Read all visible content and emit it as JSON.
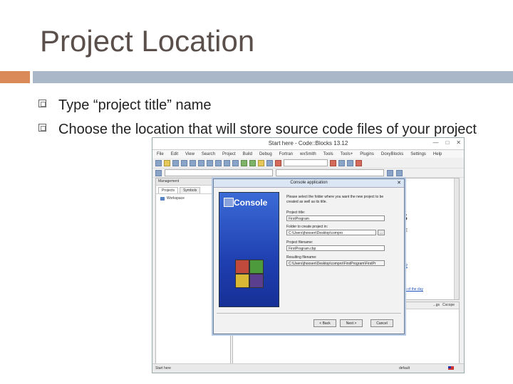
{
  "slide": {
    "title": "Project Location",
    "bullets": [
      "Type “project title” name",
      "Choose the location that will store source code files of your project"
    ]
  },
  "ide": {
    "window_title": "Start here - Code::Blocks 13.12",
    "window_buttons": [
      "—",
      "□",
      "✕"
    ],
    "menu": [
      "File",
      "Edit",
      "View",
      "Search",
      "Project",
      "Build",
      "Debug",
      "Fortran",
      "wxSmith",
      "Tools",
      "Tools+",
      "Plugins",
      "DoxyBlocks",
      "Settings",
      "Help"
    ],
    "management": {
      "header": "Management",
      "tabs": [
        "Projects",
        "Symbols"
      ],
      "workspace": "Workspace"
    },
    "editor": {
      "heading_fragment": "S",
      "text_fragment": "E",
      "link1": "13.12",
      "link2": "tip of the day"
    },
    "logs_tabs": [
      "...gs",
      "Cscope"
    ],
    "status": {
      "left": "Start here",
      "middle": "default"
    }
  },
  "dialog": {
    "title": "Console application",
    "close": "✕",
    "banner_label": "Console",
    "instructions": "Please select the folder where you want the new project to be created as well as its title.",
    "fields": [
      {
        "label": "Project title:",
        "value": "FirstProgram"
      },
      {
        "label": "Folder to create project in:",
        "value": "C:\\Users\\jhoosen\\Desktop\\compro"
      },
      {
        "label": "Project filename:",
        "value": "FirstProgram.cbp"
      },
      {
        "label": "Resulting filename:",
        "value": "C:\\Users\\jhoosen\\Desktop\\compro\\FirstProgram\\FirstPr"
      }
    ],
    "browse_label": "...",
    "buttons": {
      "back": "< Back",
      "next": "Next >",
      "cancel": "Cancel"
    }
  },
  "colors": {
    "accent_orange": "#d98a58",
    "accent_blue": "#a9b7c9",
    "title": "#5a4f4a"
  }
}
